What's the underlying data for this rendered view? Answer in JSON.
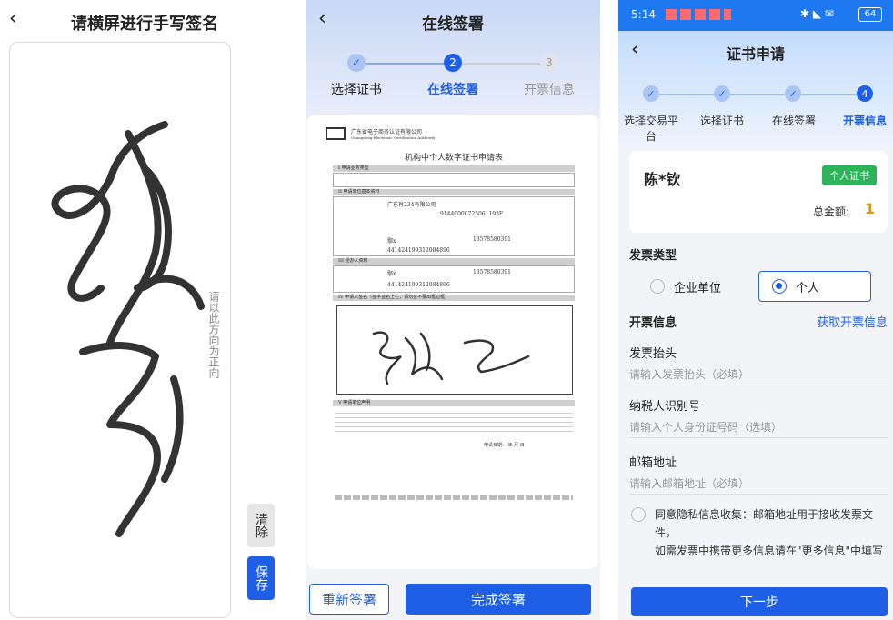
{
  "panel1": {
    "title": "请横屏进行手写签名",
    "hint": "请以此方向为正向",
    "clear_label": "清除",
    "save_label": "保存"
  },
  "panel2": {
    "title": "在线签署",
    "steps": [
      {
        "num": "✓",
        "label": "选择证书"
      },
      {
        "num": "2",
        "label": "在线签署"
      },
      {
        "num": "3",
        "label": "开票信息"
      }
    ],
    "doc": {
      "company": "广东省电子商务认证有限公司",
      "company_en": "Guangdong Electronic Certification Authority",
      "title": "机构中个人数字证书申请表",
      "sec1": "I 申请业务类型",
      "sec2": "II 申请单位基本资料",
      "sec3": "III 经办人资料",
      "sec4": "IV 申请人签名（签字签名上栏，请勿签不要出框边框）",
      "sec5": "V 申请单位声明",
      "org_name": "广东肖234有限公司",
      "credit_code": "91440000725061193F",
      "person1": "鄢x",
      "phone1": "13578580391",
      "id1": "441424199312084896",
      "person2": "鄢x",
      "phone2": "13578580391",
      "id2": "441424199312084896",
      "date_label": "申请日期：    年    月    日"
    },
    "resign_label": "重新签署",
    "finish_label": "完成签署"
  },
  "panel3": {
    "status_time": "5:14",
    "status_battery": "64",
    "title": "证书申请",
    "steps": [
      {
        "num": "✓",
        "label": "选择交易平台"
      },
      {
        "num": "✓",
        "label": "选择证书"
      },
      {
        "num": "✓",
        "label": "在线签署"
      },
      {
        "num": "4",
        "label": "开票信息"
      }
    ],
    "user_name": "陈*钦",
    "cert_tag": "个人证书",
    "total_label": "总金额:",
    "total_value": "1",
    "invoice_type_label": "发票类型",
    "option_company": "企业单位",
    "option_personal": "个人",
    "invoice_info_label": "开票信息",
    "get_invoice_link": "获取开票信息",
    "header_label": "发票抬头",
    "header_placeholder": "请输入发票抬头（必填）",
    "taxid_label": "纳税人识别号",
    "taxid_placeholder": "请输入个人身份证号码（选填）",
    "email_label": "邮箱地址",
    "email_placeholder": "请输入邮箱地址（必填）",
    "agree_text1": "同意隐私信息收集：邮箱地址用于接收发票文件，",
    "agree_text2": "如需发票中携带更多信息请在\"更多信息\"中填写",
    "next_label": "下一步",
    "accent": "#1f5fe6",
    "tag_color": "#2db35a"
  }
}
